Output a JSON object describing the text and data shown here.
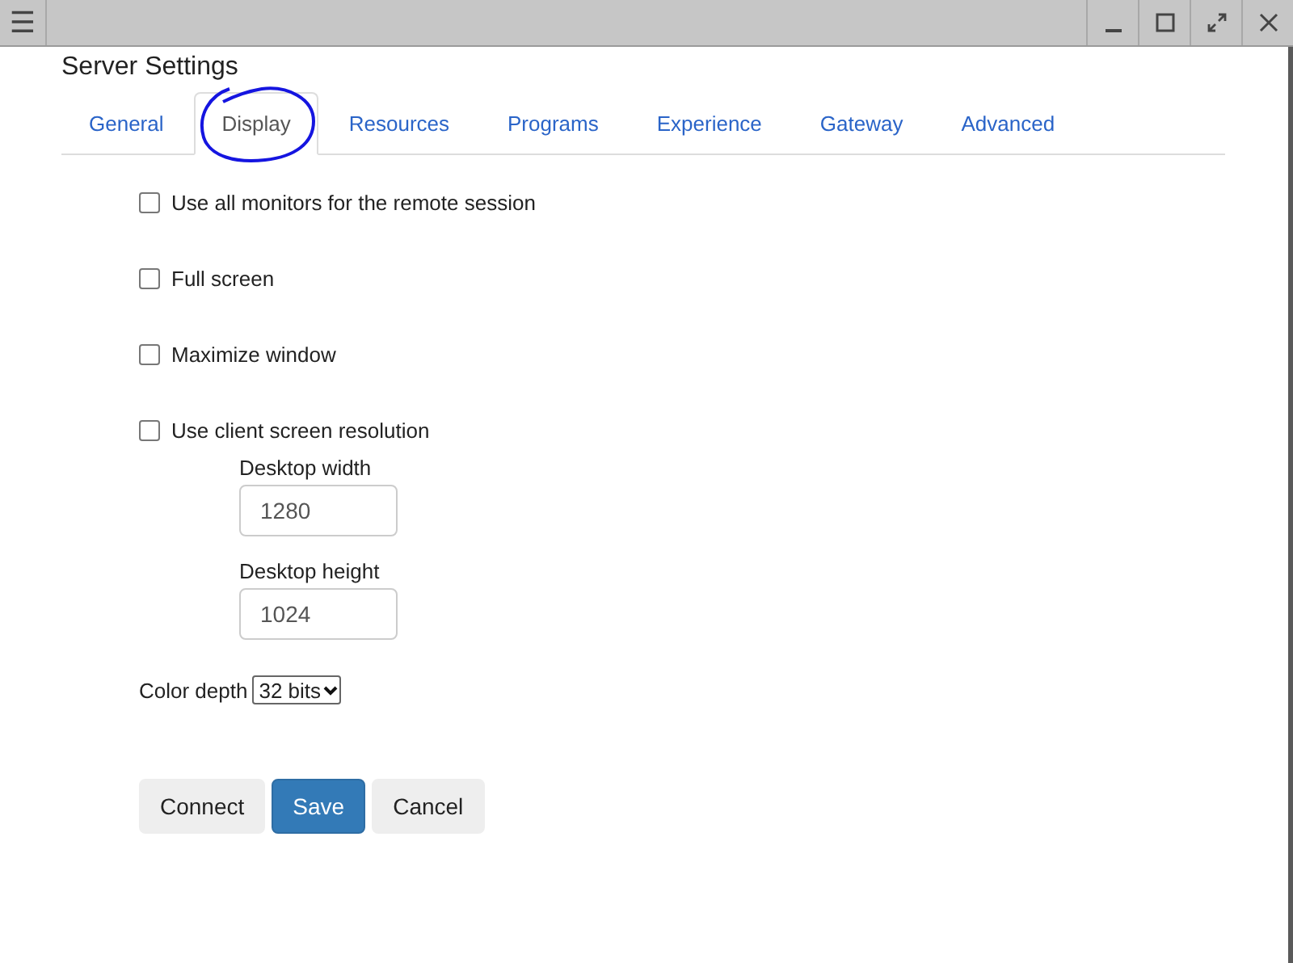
{
  "window": {
    "menu_icon": "☰"
  },
  "title": "Server Settings",
  "tabs": [
    {
      "label": "General",
      "selected": false
    },
    {
      "label": "Display",
      "selected": true,
      "circled": true
    },
    {
      "label": "Resources",
      "selected": false
    },
    {
      "label": "Programs",
      "selected": false
    },
    {
      "label": "Experience",
      "selected": false
    },
    {
      "label": "Gateway",
      "selected": false
    },
    {
      "label": "Advanced",
      "selected": false
    }
  ],
  "options": [
    {
      "label": "Use all monitors for the remote session",
      "checked": false
    },
    {
      "label": "Full screen",
      "checked": false
    },
    {
      "label": "Maximize window",
      "checked": false
    },
    {
      "label": "Use client screen resolution",
      "checked": false
    }
  ],
  "fields": [
    {
      "label": "Desktop width",
      "value": "1280"
    },
    {
      "label": "Desktop height",
      "value": "1024"
    }
  ],
  "color_depth": {
    "label": "Color depth",
    "value": "32 bits"
  },
  "buttons": [
    {
      "label": "Connect",
      "kind": "default"
    },
    {
      "label": "Save",
      "kind": "primary"
    },
    {
      "label": "Cancel",
      "kind": "default"
    }
  ]
}
